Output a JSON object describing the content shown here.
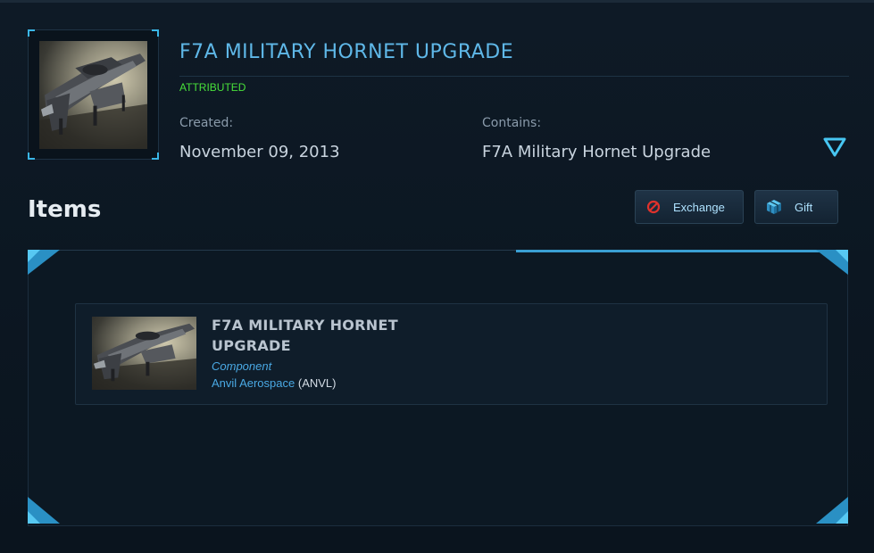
{
  "pledge": {
    "title": "F7A MILITARY HORNET UPGRADE",
    "status": "ATTRIBUTED",
    "created_label": "Created:",
    "created_value": "November 09, 2013",
    "contains_label": "Contains:",
    "contains_value": "F7A Military Hornet Upgrade"
  },
  "items_section": {
    "title": "Items",
    "exchange_label": "Exchange",
    "gift_label": "Gift"
  },
  "items": [
    {
      "name": "F7A MILITARY HORNET UPGRADE",
      "type": "Component",
      "manufacturer": "Anvil Aerospace",
      "manufacturer_code_open": " (",
      "manufacturer_code": "ANVL",
      "manufacturer_code_close": ")"
    }
  ],
  "colors": {
    "accent": "#3a9fd3",
    "title_blue": "#5fb8e8",
    "status_green": "#48e03a",
    "exchange_icon_red": "#e0322c"
  },
  "icons": {
    "expand": "triangle-down-icon",
    "exchange": "prohibited-icon",
    "gift": "gift-cube-icon"
  }
}
